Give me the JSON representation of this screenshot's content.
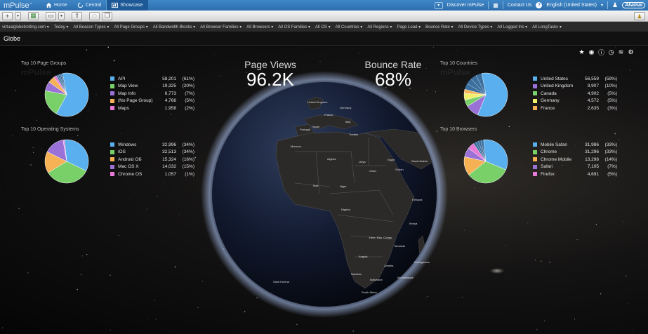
{
  "app": {
    "brand": "mPulse",
    "tm": "™",
    "nav": [
      {
        "label": "Home",
        "icon": "home-icon"
      },
      {
        "label": "Central",
        "icon": "refresh-icon"
      },
      {
        "label": "Showcase",
        "icon": "dashboard-icon"
      }
    ],
    "discover": "Discover mPulse",
    "contact": "Contact Us",
    "language": "English (United States)",
    "vendor": "Akamai"
  },
  "filters": [
    "virtualglobetrotting.com",
    "Today",
    "All Beacon Types",
    "All Page Groups",
    "All Bandwidth Blocks",
    "All Browser Families",
    "All Browsers",
    "All OS Families",
    "All OS",
    "All Countries",
    "All Regions",
    "Page Load",
    "Bounce Rate",
    "All Device Types",
    "All Logged Ins",
    "All LongTasks"
  ],
  "page_title": "Globe",
  "watermark": "mPulse",
  "kpis": {
    "page_views": {
      "label": "Page Views",
      "value": "96.2K"
    },
    "bounce_rate": {
      "label": "Bounce Rate",
      "value": "68%"
    }
  },
  "panels": {
    "page_groups": {
      "title": "Top 10 Page Groups",
      "items": [
        {
          "label": "API",
          "value": "58,201",
          "pct": "(61%)",
          "color": "#5ab0ee",
          "frac": 0.61
        },
        {
          "label": "Map View",
          "value": "19,325",
          "pct": "(20%)",
          "color": "#79d068",
          "frac": 0.2
        },
        {
          "label": "Map Info",
          "value": "6,773",
          "pct": "(7%)",
          "color": "#9a71d6",
          "frac": 0.07
        },
        {
          "label": "(No Page Group)",
          "value": "4,768",
          "pct": "(5%)",
          "color": "#f5b153",
          "frac": 0.05
        },
        {
          "label": "Maps",
          "value": "1,958",
          "pct": "(2%)",
          "color": "#e77ad6",
          "frac": 0.02
        }
      ]
    },
    "operating_systems": {
      "title": "Top 10 Operating Systems",
      "items": [
        {
          "label": "Windows",
          "value": "32,996",
          "pct": "(34%)",
          "color": "#5ab0ee",
          "frac": 0.34
        },
        {
          "label": "iOS",
          "value": "32,513",
          "pct": "(34%)",
          "color": "#79d068",
          "frac": 0.34
        },
        {
          "label": "Android OS",
          "value": "15,324",
          "pct": "(16%)",
          "color": "#f5b153",
          "frac": 0.16
        },
        {
          "label": "Mac OS X",
          "value": "14,032",
          "pct": "(15%)",
          "color": "#9a71d6",
          "frac": 0.15
        },
        {
          "label": "Chrome OS",
          "value": "1,057",
          "pct": "(1%)",
          "color": "#e77ad6",
          "frac": 0.01
        }
      ]
    },
    "countries": {
      "title": "Top 10 Countries",
      "items": [
        {
          "label": "United States",
          "value": "56,559",
          "pct": "(59%)",
          "color": "#5ab0ee",
          "frac": 0.59
        },
        {
          "label": "United Kingdom",
          "value": "9,907",
          "pct": "(10%)",
          "color": "#9a71d6",
          "frac": 0.1
        },
        {
          "label": "Canada",
          "value": "4,902",
          "pct": "(5%)",
          "color": "#79d068",
          "frac": 0.05
        },
        {
          "label": "Germany",
          "value": "4,572",
          "pct": "(5%)",
          "color": "#f2ef6a",
          "frac": 0.05
        },
        {
          "label": "France",
          "value": "2,635",
          "pct": "(3%)",
          "color": "#f5b153",
          "frac": 0.03
        }
      ]
    },
    "browsers": {
      "title": "Top 10 Browsers",
      "items": [
        {
          "label": "Mobile Safari",
          "value": "31,986",
          "pct": "(33%)",
          "color": "#5ab0ee",
          "frac": 0.33
        },
        {
          "label": "Chrome",
          "value": "31,296",
          "pct": "(33%)",
          "color": "#79d068",
          "frac": 0.33
        },
        {
          "label": "Chrome Mobile",
          "value": "13,298",
          "pct": "(14%)",
          "color": "#f5b153",
          "frac": 0.14
        },
        {
          "label": "Safari",
          "value": "7,105",
          "pct": "(7%)",
          "color": "#9a71d6",
          "frac": 0.07
        },
        {
          "label": "Firefox",
          "value": "4,691",
          "pct": "(5%)",
          "color": "#e77ad6",
          "frac": 0.05
        }
      ]
    }
  },
  "globe_labels": [
    "United Kingdom",
    "Germany",
    "France",
    "Spain",
    "Portugal",
    "Italy",
    "Tunisia",
    "Morocco",
    "Algeria",
    "Libya",
    "Egypt",
    "Saudi Arabia",
    "Mali",
    "Niger",
    "Chad",
    "Sudan",
    "Ethiopia",
    "Nigeria",
    "Kenya",
    "Dem. Rep. Congo",
    "Tanzania",
    "Angola",
    "Zambia",
    "Namibia",
    "Botswana",
    "South Africa",
    "Madagascar",
    "Mozambique",
    "Saint Helena"
  ],
  "chart_data": [
    {
      "type": "pie",
      "title": "Top 10 Page Groups",
      "categories": [
        "API",
        "Map View",
        "Map Info",
        "(No Page Group)",
        "Maps"
      ],
      "values": [
        58201,
        19325,
        6773,
        4768,
        1958
      ]
    },
    {
      "type": "pie",
      "title": "Top 10 Operating Systems",
      "categories": [
        "Windows",
        "iOS",
        "Android OS",
        "Mac OS X",
        "Chrome OS"
      ],
      "values": [
        32996,
        32513,
        15324,
        14032,
        1057
      ]
    },
    {
      "type": "pie",
      "title": "Top 10 Countries",
      "categories": [
        "United States",
        "United Kingdom",
        "Canada",
        "Germany",
        "France"
      ],
      "values": [
        56559,
        9907,
        4902,
        4572,
        2635
      ]
    },
    {
      "type": "pie",
      "title": "Top 10 Browsers",
      "categories": [
        "Mobile Safari",
        "Chrome",
        "Chrome Mobile",
        "Safari",
        "Firefox"
      ],
      "values": [
        31986,
        31296,
        13298,
        7105,
        4691
      ]
    }
  ]
}
